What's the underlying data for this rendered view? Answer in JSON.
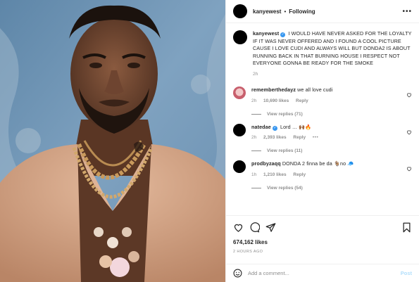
{
  "header": {
    "username": "kanyewest",
    "separator": "•",
    "follow_label": "Following",
    "more_glyph": "•••"
  },
  "caption": {
    "username": "kanyewest",
    "text": "I WOULD HAVE NEVER ASKED FOR THE LOYALTY IF IT WAS NEVER OFFERED AND I FOUND A COOL PICTURE CAUSE I LOVE CUDI AND ALWAYS WILL BUT DONDA2 IS ABOUT RUNNING BACK IN THAT BURNING HOUSE I RESPECT NOT EVERYONE GONNA BE READY FOR THE SMOKE",
    "time": "2h"
  },
  "comments": [
    {
      "username": "rememberthedayz",
      "verified": false,
      "text": "we all love cudi",
      "time": "2h",
      "likes": "10,690 likes",
      "reply": "Reply",
      "view_replies": "View replies (71)"
    },
    {
      "username": "natedae",
      "verified": true,
      "text": "Lord … 🙌🏾🔥",
      "time": "2h",
      "likes": "2,393 likes",
      "reply": "Reply",
      "more": "•••",
      "view_replies": "View replies (11)"
    },
    {
      "username": "prodbyzaqq",
      "verified": false,
      "text": "DONDA 2 finna be da 🐐no 🧢",
      "time": "1h",
      "likes": "1,210 likes",
      "reply": "Reply",
      "view_replies": "View replies (54)"
    }
  ],
  "verified_glyph": "✓",
  "footer": {
    "likes": "674,162 likes",
    "ago": "2 HOURS AGO",
    "add_comment_placeholder": "Add a comment...",
    "post_label": "Post"
  },
  "icons": [
    "more-icon",
    "verified-icon",
    "heart-icon",
    "comment-icon",
    "share-icon",
    "bookmark-icon",
    "emoji-icon"
  ],
  "colors": {
    "link_blue": "#3897f0",
    "muted": "#8e8e8e",
    "post_disabled": "#b2dffc",
    "text": "#262626"
  }
}
